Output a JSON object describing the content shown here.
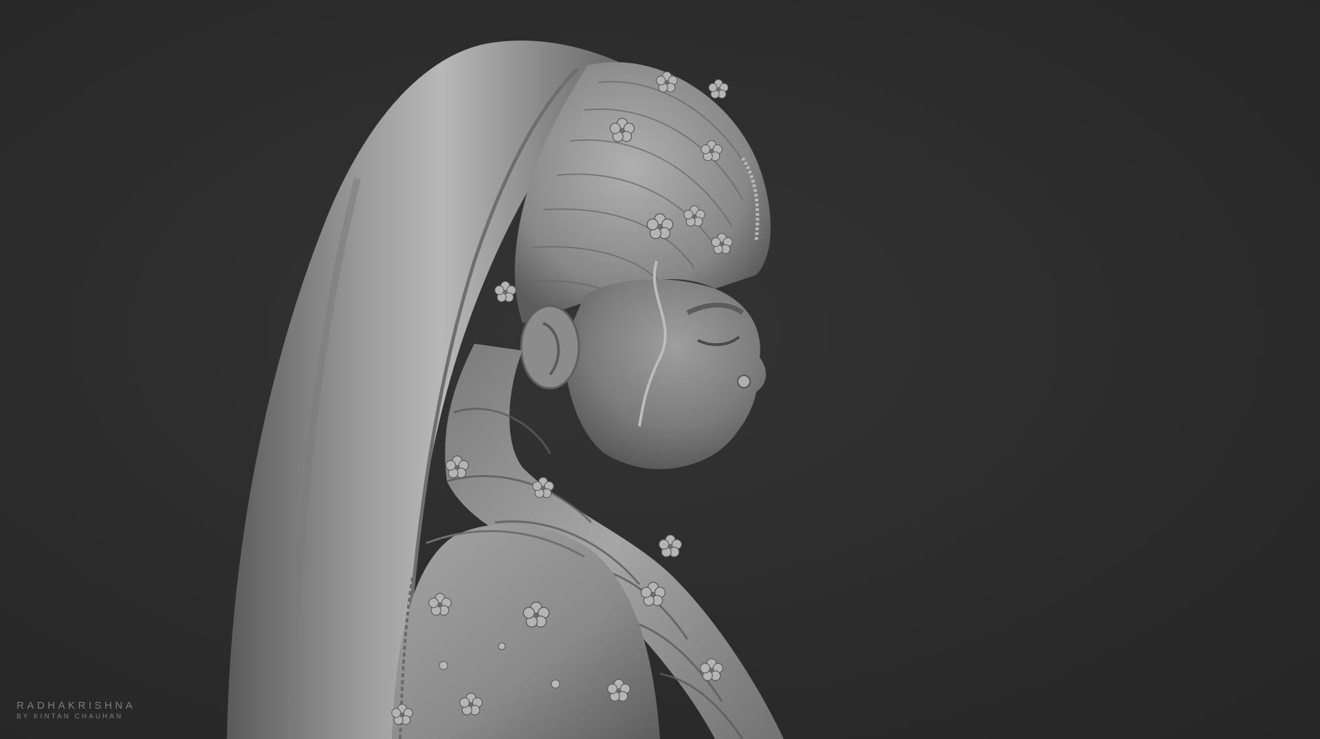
{
  "render": {
    "background_color": "#2c2c2c",
    "clay_color": "#9a9a9a",
    "subject_icon": "clay-bust-render"
  },
  "caption": {
    "title": "RADHAKRISHNA",
    "credit": "BY KINTAN CHAUHAN"
  }
}
